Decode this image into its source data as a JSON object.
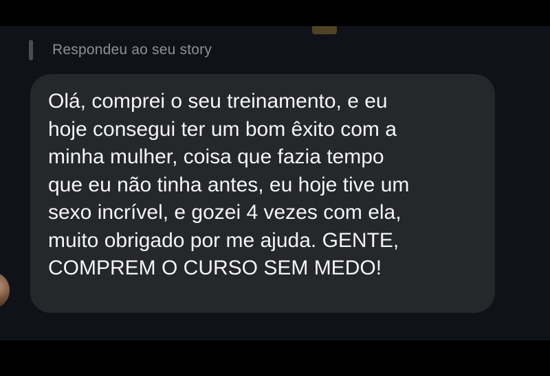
{
  "reply": {
    "label": "Respondeu ao seu story"
  },
  "message": {
    "lines": [
      "Olá, comprei o seu treinamento, e eu",
      "hoje consegui ter um bom êxito com a",
      "minha mulher, coisa que fazia tempo",
      "que eu não tinha antes, eu hoje tive um",
      "sexo incrível, e gozei 4 vezes com ela,",
      "muito obrigado por me ajuda. GENTE,",
      "COMPREM O CURSO SEM MEDO!"
    ]
  },
  "colors": {
    "background": "#000000",
    "chat_background": "#10121a",
    "bubble": "#25272b",
    "text": "#f5f5f7",
    "muted_text": "#8e9096"
  }
}
